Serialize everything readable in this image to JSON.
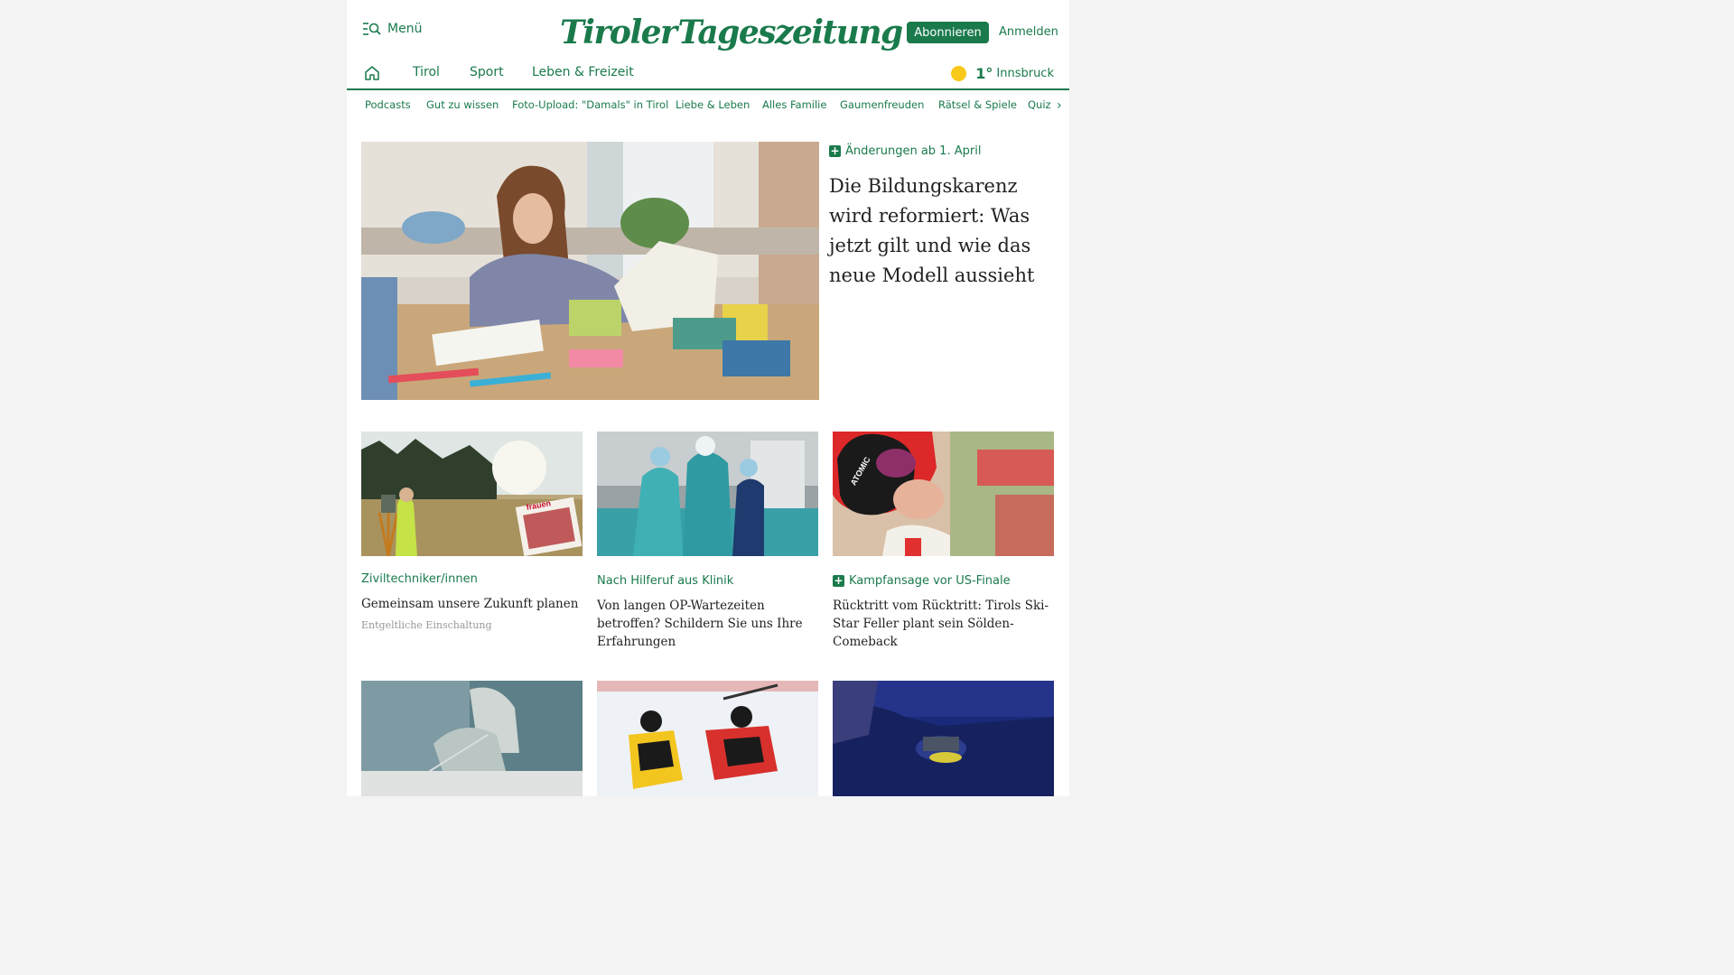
{
  "header": {
    "menu_label": "Menü",
    "logo_left": "Tiroler",
    "logo_right": "Tageszeitung",
    "subscribe_label": "Abonnieren",
    "login_label": "Anmelden"
  },
  "mainnav": {
    "items": [
      {
        "label": "Tirol"
      },
      {
        "label": "Sport"
      },
      {
        "label": "Leben & Freizeit"
      }
    ],
    "weather": {
      "temperature": "1°",
      "city": "Innsbruck"
    }
  },
  "subnav": {
    "items": [
      {
        "label": "Podcasts"
      },
      {
        "label": "Gut zu wissen"
      },
      {
        "label": "Foto-Upload: \"Damals\" in Tirol"
      },
      {
        "label": "Liebe & Leben"
      },
      {
        "label": "Alles Familie"
      },
      {
        "label": "Gaumenfreuden"
      },
      {
        "label": "Rätsel & Spiele"
      },
      {
        "label": "Quiz"
      }
    ]
  },
  "hero": {
    "kicker": "Änderungen ab 1. April",
    "title": "Die Bildungskarenz wird reformiert: Was jetzt gilt und wie das neue Modell aussieht"
  },
  "cards": [
    {
      "kicker": "Ziviltechniker/innen",
      "title": "Gemeinsam unsere Zukunft planen",
      "ad_label": "Entgeltliche Einschaltung",
      "image_text": "frauen"
    },
    {
      "kicker": "Nach Hilferuf aus Klinik",
      "title": "Von langen OP-Wartezeiten betroffen? Schildern Sie uns Ihre Erfahrungen"
    },
    {
      "kicker": "Kampfansage vor US-Finale",
      "title": "Rücktritt vom Rücktritt: Tirols Ski-Star Feller plant sein Sölden-Comeback",
      "image_text": "ATOMIC"
    }
  ],
  "colors": {
    "brand_green": "#1a7a4c",
    "sun_yellow": "#f8c91a"
  }
}
